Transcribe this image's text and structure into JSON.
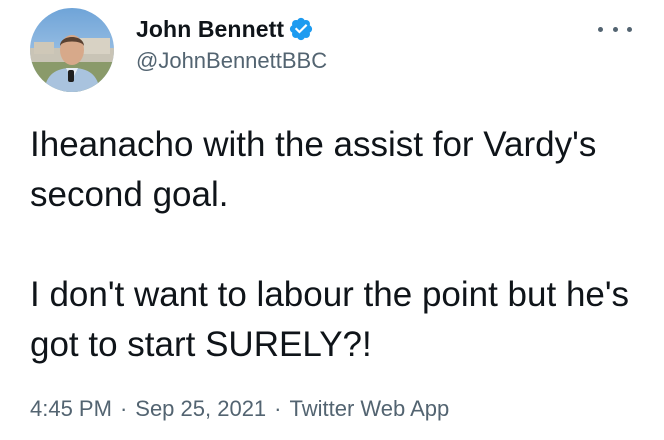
{
  "author": {
    "display_name": "John Bennett",
    "handle": "@JohnBennettBBC",
    "verified": true
  },
  "icons": {
    "verified": "verified-badge-icon",
    "more": "more-options-icon"
  },
  "colors": {
    "verified_blue": "#1d9bf0",
    "text_primary": "#0f1419",
    "text_secondary": "#536471"
  },
  "tweet": {
    "paragraphs": [
      "Iheanacho with the assist for Vardy's second goal.",
      "I don't want to labour the point but he's got to start SURELY?!"
    ]
  },
  "meta": {
    "time": "4:45 PM",
    "separator": "·",
    "date": "Sep 25, 2021",
    "source": "Twitter Web App"
  }
}
